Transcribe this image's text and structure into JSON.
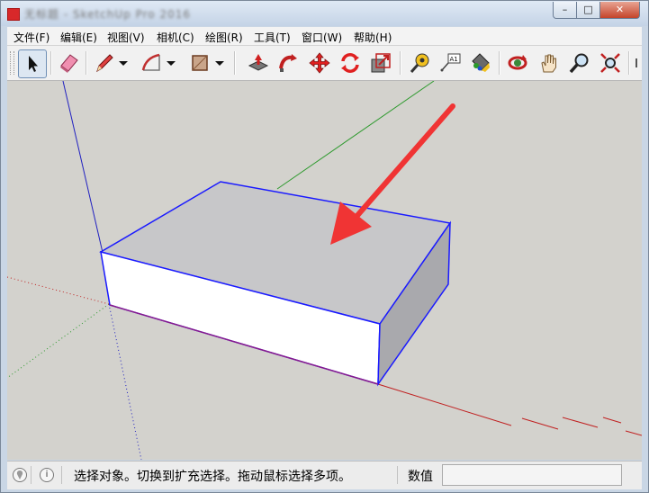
{
  "window": {
    "title": "无标题 - SketchUp Pro 2016",
    "minimize_label": "–",
    "maximize_label": "□",
    "close_label": "✕"
  },
  "menu": [
    {
      "label": "文件(F)",
      "name": "menu-file"
    },
    {
      "label": "编辑(E)",
      "name": "menu-edit"
    },
    {
      "label": "视图(V)",
      "name": "menu-view"
    },
    {
      "label": "相机(C)",
      "name": "menu-camera"
    },
    {
      "label": "绘图(R)",
      "name": "menu-draw"
    },
    {
      "label": "工具(T)",
      "name": "menu-tools"
    },
    {
      "label": "窗口(W)",
      "name": "menu-window"
    },
    {
      "label": "帮助(H)",
      "name": "menu-help"
    }
  ],
  "toolbar": {
    "tools": [
      "select-icon",
      "eraser-icon",
      "pencil-line-icon",
      "arc-icon",
      "rectangle-icon",
      "push-pull-icon",
      "follow-me-icon",
      "move-icon",
      "rotate-icon",
      "scale-icon",
      "tape-measure-icon",
      "text-label-icon",
      "paint-bucket-icon",
      "orbit-icon",
      "pan-icon",
      "zoom-icon",
      "zoom-extents-icon"
    ],
    "text_label_glyph": "A1",
    "selected_tool": "select-icon"
  },
  "colors": {
    "viewport_bg": "#d3d2cd",
    "red_axis": "#c02020",
    "green_axis": "#2e9a2e",
    "blue_axis": "#2020c0",
    "selection_edge": "#1a1aff",
    "top_face": "#c7c7c9",
    "front_face": "#ffffff",
    "side_face": "#a9a9ad",
    "arrow": "#f03434"
  },
  "status": {
    "message": "选择对象。切换到扩充选择。拖动鼠标选择多项。",
    "measurements_label": "数值",
    "measurements_value": "",
    "info_icon_glyph": "i"
  }
}
